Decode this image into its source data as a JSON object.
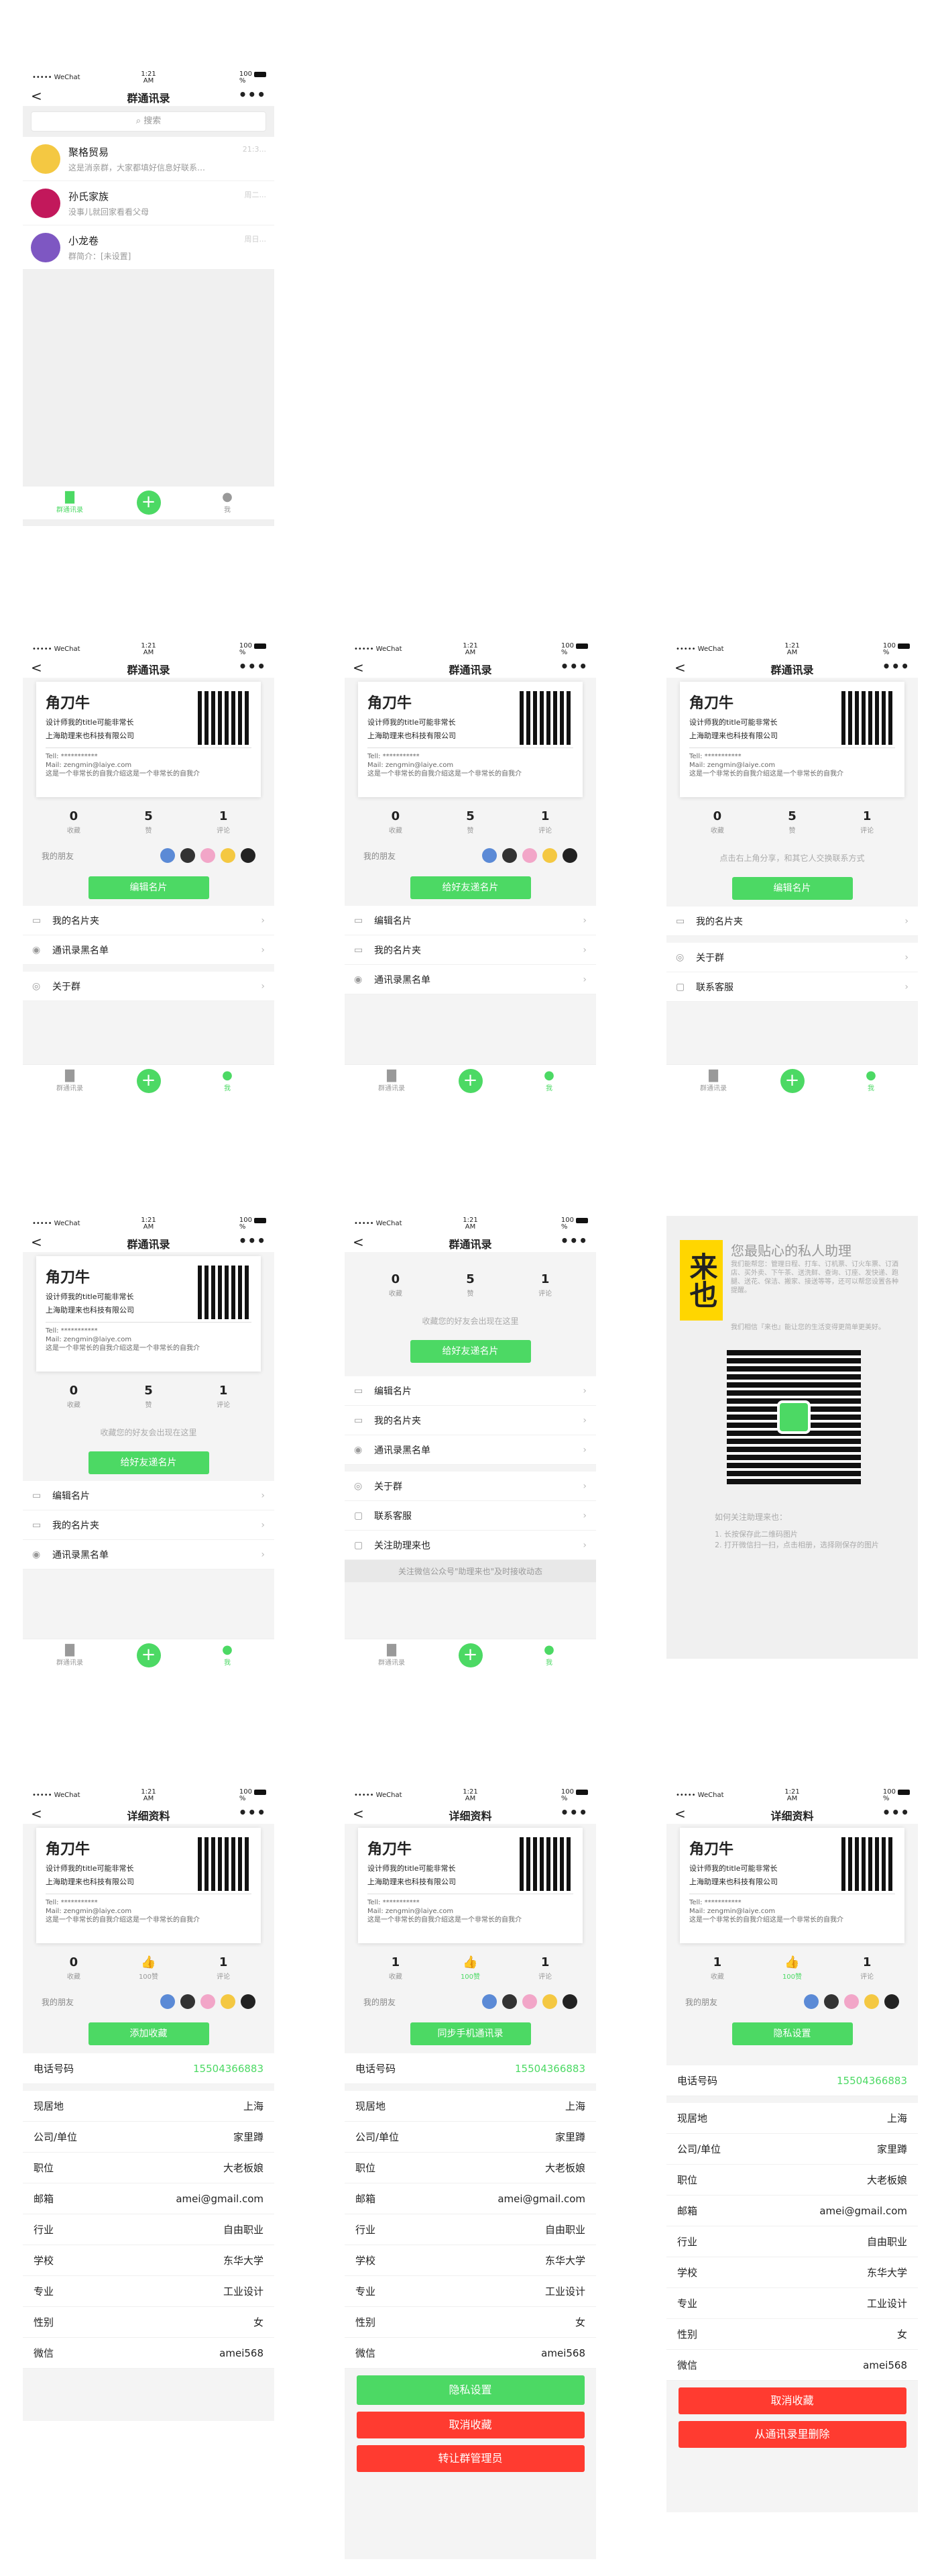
{
  "status": {
    "carrier": "••••• WeChat",
    "time": "1:21\nAM",
    "battery": "100\n%"
  },
  "nav": {
    "title": "群通讯录",
    "title_detail": "详细资料",
    "back": "<",
    "more": "•••"
  },
  "search": {
    "placeholder": "搜索"
  },
  "groups": [
    {
      "name": "聚格贸易",
      "desc": "这是消亲群，大家都填好信息好联系…",
      "time": "21:3..."
    },
    {
      "name": "孙氏家族",
      "desc": "没事儿就回家看看父母",
      "time": "周二..."
    },
    {
      "name": "小龙卷",
      "desc": "群简介：[未设置]",
      "time": "周日..."
    }
  ],
  "tabs": {
    "tab1": "群通讯录",
    "tab2": "我"
  },
  "card": {
    "name": "角刀牛",
    "line1": "设计师我的title可能非常长",
    "line2": "上海助理来也科技有限公司",
    "tel": "Tell: ***********",
    "mail": "Mail: zengmin@laiye.com",
    "intro": "这是一个非常长的自我介绍这是一个非常长的自我介"
  },
  "stats": [
    {
      "n": "0",
      "l": "收藏"
    },
    {
      "n": "5",
      "l": "赞"
    },
    {
      "n": "1",
      "l": "评论"
    }
  ],
  "friends_label": "我的朋友",
  "hints": {
    "tap_share": "点击右上角分享，和其它人交换联系方式",
    "no_friend": "收藏您的好友会出现在这里",
    "follow": "关注微信公众号\"助理来也\"及时接收动态"
  },
  "buttons": {
    "edit_card": "编辑名片",
    "send_friend": "给好友递名片",
    "add_fav": "添加收藏",
    "sync": "同步手机通讯录",
    "privacy": "隐私设置",
    "cancel_fav": "取消收藏",
    "transfer": "转让群管理员",
    "remove": "从通讯录里删除"
  },
  "menu": {
    "my_cards": "我的名片夹",
    "blacklist": "通讯录黑名单",
    "about": "关于群",
    "service": "联系客服",
    "follow": "关注助理来也",
    "edit": "编辑名片"
  },
  "promo": {
    "logo": "来也",
    "title": "您最贴心的私人助理",
    "body": "我们能帮您：管理日程、打车、订机票、订火车票、订酒店、买外卖、下午茶、送洗鲜、查询、订座、发快递、跑腿、送花、保洁、搬家、接送等等，还可以帮您设置各种提醒。",
    "body2": "我们相信『来也』能让您的生活变得更简单更美好。",
    "how": "如何关注助理来也：",
    "step1": "1. 长按保存此二维码图片",
    "step2": "2. 打开微信扫一扫，点击相册，选择刚保存的图片"
  },
  "detail": {
    "phone_label": "电话号码",
    "phone": "15504366883",
    "rows": [
      {
        "k": "现居地",
        "v": "上海"
      },
      {
        "k": "公司/单位",
        "v": "家里蹲"
      },
      {
        "k": "职位",
        "v": "大老板娘"
      },
      {
        "k": "邮箱",
        "v": "amei@gmail.com"
      },
      {
        "k": "行业",
        "v": "自由职业"
      },
      {
        "k": "学校",
        "v": "东华大学"
      },
      {
        "k": "专业",
        "v": "工业设计"
      },
      {
        "k": "性别",
        "v": "女"
      },
      {
        "k": "微信",
        "v": "amei568"
      }
    ],
    "likes_label": "赞",
    "likes_100": "100"
  },
  "colors": {
    "green": "#4cd964",
    "red": "#ff3b30"
  }
}
